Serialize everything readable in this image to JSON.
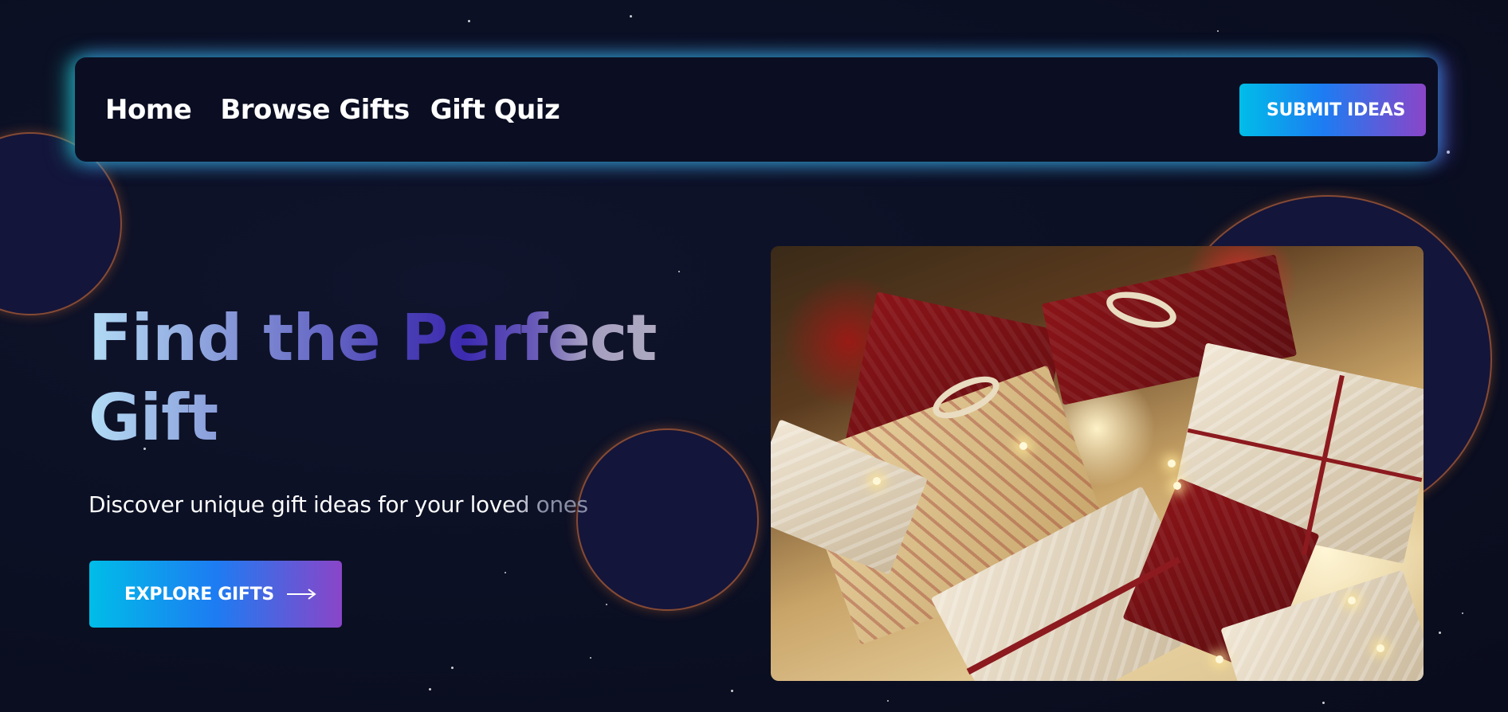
{
  "nav": {
    "links": [
      {
        "label": "Home"
      },
      {
        "label": "Browse Gifts"
      },
      {
        "label": "Gift Quiz"
      }
    ],
    "submit_label": "SUBMIT IDEAS"
  },
  "hero": {
    "title": "Find the Perfect Gift",
    "subtitle": "Discover unique gift ideas for your loved ones",
    "cta_label": "EXPLORE GIFTS",
    "cta_icon": "arrow-right-icon",
    "image_icon": "christmas-gifts-photo"
  },
  "colors": {
    "background": "#0c1024",
    "nav_background": "#0b0e22",
    "button_gradient_start": "#00bde8",
    "button_gradient_mid": "#1d7cf2",
    "button_gradient_end": "#8a45c8",
    "glow_teal": "#20dcbe",
    "bubble_border": "#e27630"
  }
}
